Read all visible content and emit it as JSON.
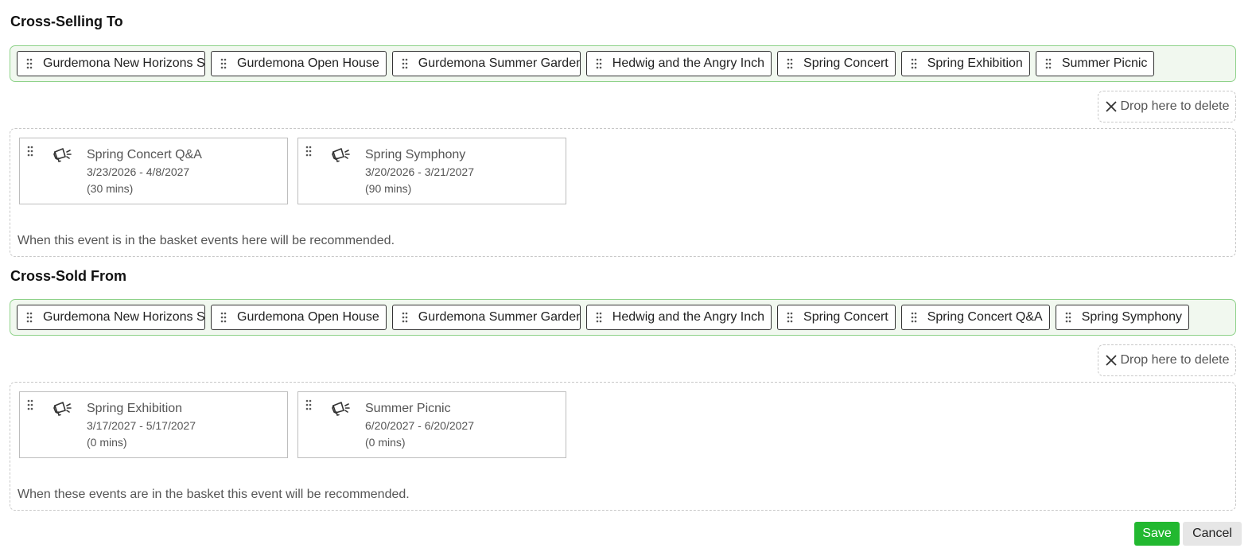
{
  "cross_selling_to": {
    "title": "Cross-Selling To",
    "chips": [
      "Gurdemona New Horizons Show",
      "Gurdemona Open House",
      "Gurdemona Summer Garden",
      "Hedwig and the Angry Inch",
      "Spring Concert",
      "Spring Exhibition",
      "Summer Picnic"
    ],
    "drop_delete_label": "Drop here to delete",
    "cards": [
      {
        "title": "Spring Concert Q&A",
        "dates": "3/23/2026 - 4/8/2027",
        "duration": "(30 mins)"
      },
      {
        "title": "Spring Symphony",
        "dates": "3/20/2026 - 3/21/2027",
        "duration": "(90 mins)"
      }
    ],
    "hint": "When this event is in the basket events here will be recommended."
  },
  "cross_sold_from": {
    "title": "Cross-Sold From",
    "chips": [
      "Gurdemona New Horizons Show",
      "Gurdemona Open House",
      "Gurdemona Summer Garden",
      "Hedwig and the Angry Inch",
      "Spring Concert",
      "Spring Concert Q&A",
      "Spring Symphony"
    ],
    "drop_delete_label": "Drop here to delete",
    "cards": [
      {
        "title": "Spring Exhibition",
        "dates": "3/17/2027 - 5/17/2027",
        "duration": "(0 mins)"
      },
      {
        "title": "Summer Picnic",
        "dates": "6/20/2027 - 6/20/2027",
        "duration": "(0 mins)"
      }
    ],
    "hint": "When these events are in the basket this event will be recommended."
  },
  "actions": {
    "save_label": "Save",
    "cancel_label": "Cancel"
  },
  "colors": {
    "tray_border": "#8fd28a",
    "tray_background": "#f1f8ef",
    "save_button": "#22b830"
  },
  "icons": {
    "chip_handle": "drag-handle-icon",
    "card_handle": "drag-handle-icon",
    "card_event": "megaphone-icon",
    "delete": "close-icon"
  }
}
